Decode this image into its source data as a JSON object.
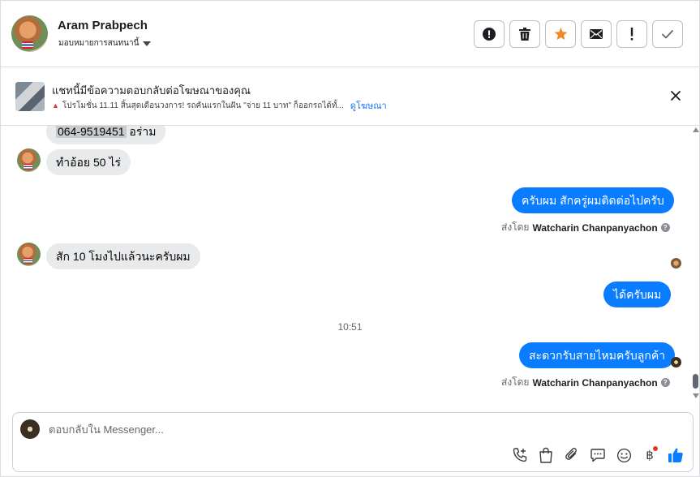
{
  "header": {
    "contact_name": "Aram Prabpech",
    "assign_label": "มอบหมายการสนทนานี้",
    "actions": [
      {
        "icon": "alert-circle-icon",
        "name": "mark-important-button"
      },
      {
        "icon": "trash-icon",
        "name": "delete-button"
      },
      {
        "icon": "star-icon",
        "name": "star-button",
        "color": "#f08a24"
      },
      {
        "icon": "envelope-icon",
        "name": "mark-unread-button"
      },
      {
        "icon": "exclamation-icon",
        "name": "spam-button"
      },
      {
        "icon": "check-icon",
        "name": "mark-done-button"
      }
    ]
  },
  "ad_banner": {
    "title": "แชทนี้มีข้อความตอบกลับต่อโฆษณาของคุณ",
    "description": "โปรโมชั่น 11.11 สิ้นสุดเดือนวงการ! รถคันแรกในฝัน \"จ่าย 11 บาท\" ก็ออกรถได้ทั้...",
    "link": "ดูโฆษณา"
  },
  "messages": {
    "m1_phone": "064-9519451",
    "m1_rest": " อร่าม",
    "m2": "ทำอ้อย 50 ไร่",
    "m3": "ครับผม สักครู่ผมติดต่อไปครับ",
    "m3_sentby_prefix": "ส่งโดย",
    "m3_sentby_name": "Watcharin Chanpanyachon",
    "m4": "สัก 10 โมงไปแล้วนะครับผม",
    "m5": "ได้ครับผม",
    "timestamp": "10:51",
    "m6": "สะดวกรับสายไหมครับลูกค้า",
    "m6_sentby_prefix": "ส่งโดย",
    "m6_sentby_name": "Watcharin Chanpanyachon"
  },
  "composer": {
    "placeholder": "ตอบกลับใน Messenger...",
    "baht_symbol": "฿"
  },
  "colors": {
    "outgoing_bubble": "#0a7cff",
    "incoming_bubble": "#e9eaec",
    "link": "#1877f2",
    "like": "#0a7cff"
  }
}
